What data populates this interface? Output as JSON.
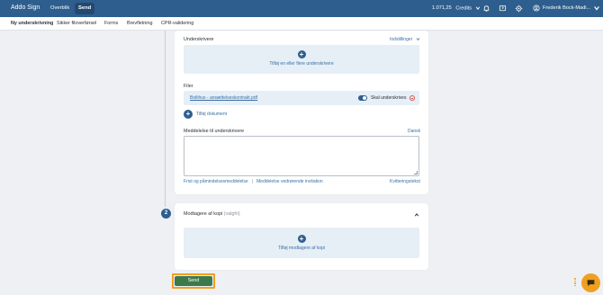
{
  "app": {
    "title": "Addo Sign"
  },
  "topnav": {
    "items": [
      {
        "label": "Overblik",
        "active": false
      },
      {
        "label": "Send",
        "active": true
      }
    ]
  },
  "header": {
    "credits_value": "1.071,25",
    "credits_label": "Credits",
    "user_name": "Frederik Bock-Madi..."
  },
  "subnav": {
    "tabs": [
      {
        "label": "Ny underskrivning",
        "active": true
      },
      {
        "label": "Sikker filoverførsel",
        "active": false
      },
      {
        "label": "Forms",
        "active": false
      },
      {
        "label": "Brevfletning",
        "active": false
      },
      {
        "label": "CPR-validering",
        "active": false
      }
    ]
  },
  "signers": {
    "title": "Underskrivere",
    "settings_link": "Indstillinger",
    "add_text": "Tilføj en eller flere underskrivere"
  },
  "files": {
    "title": "Filer",
    "file_name": "Boliihus - ansættelseskontrakt.pdf",
    "toggle_label": "Skal underskrives",
    "toggle_on": true,
    "add_document": "Tilføj dokument"
  },
  "message": {
    "title": "Meddelelse til underskrivere",
    "language_link": "Dansk",
    "value": "",
    "links": [
      "Frist og påmindelsesmeddelelse",
      "Meddelelse vedrørende invitation"
    ],
    "separator": "|",
    "confirmation_link": "Kvitteringstekst"
  },
  "step2": {
    "number": "2",
    "title": "Modtagere af kopi",
    "optional": "(valgfri)",
    "add_text": "Tilføj modtagere af kopi"
  },
  "actions": {
    "send": "Send"
  },
  "colors": {
    "topbar": "#2e5e8e",
    "accent": "#3b6fa6",
    "send": "#3d7a4a",
    "highlight": "#f0a020"
  },
  "icons": [
    "bell-icon",
    "help-icon",
    "gear-icon",
    "user-icon",
    "chevron-down-icon",
    "plus-icon",
    "remove-icon",
    "chevron-up-icon",
    "chat-icon"
  ]
}
